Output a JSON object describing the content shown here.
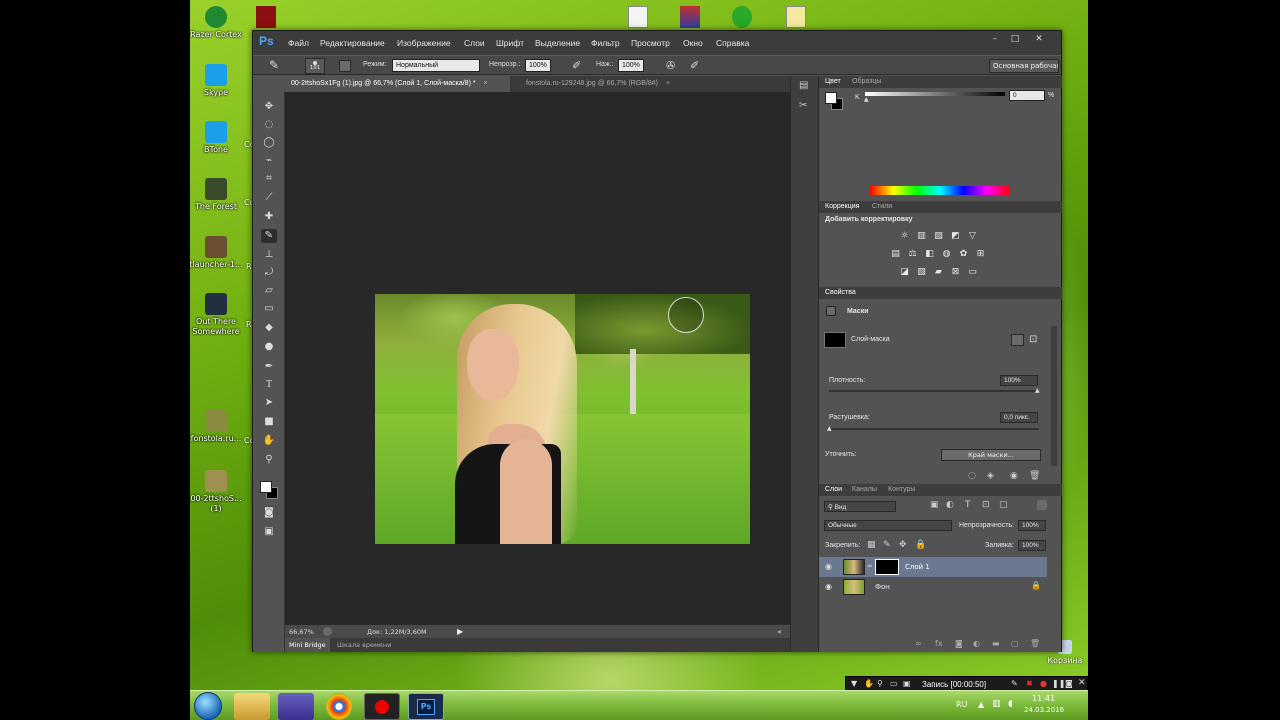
{
  "desktop": {
    "icons": [
      {
        "label": "Razer Cortex",
        "icon": "razer-cortex-icon",
        "color": "#1f8a2f"
      },
      {
        "label": "Skype",
        "icon": "skype-icon",
        "color": "#1aa0e6"
      },
      {
        "label": "BTone",
        "icon": "btone-icon",
        "color": "#1aa0e6"
      },
      {
        "label": "The Forest",
        "icon": "the-forest-icon",
        "color": "#3a4a2a"
      },
      {
        "label": "tlauncher-1...",
        "icon": "tlauncher-icon",
        "color": "#6a5030"
      },
      {
        "label": "Out There Somewhere",
        "icon": "out-there-somewhere-icon",
        "color": "#203040"
      },
      {
        "label": "fonstola.ru...",
        "icon": "image-file-icon",
        "color": "#8a8a40"
      },
      {
        "label": "00-2ttshoS... (1)",
        "icon": "image-file-icon",
        "color": "#a09050"
      }
    ],
    "partial_labels": [
      "Co",
      "Co",
      "R",
      "R",
      "Co"
    ],
    "recycle_bin": "Корзина"
  },
  "photoshop": {
    "logo": "Ps",
    "menu": [
      "Файл",
      "Редактирование",
      "Изображение",
      "Слои",
      "Шрифт",
      "Выделение",
      "Фильтр",
      "Просмотр",
      "Окно",
      "Справка"
    ],
    "window_buttons": [
      "–",
      "□",
      "✕"
    ],
    "options": {
      "brush_size": "101",
      "mode_label": "Режим:",
      "mode_value": "Нормальный",
      "opacity_label": "Непрозр.:",
      "opacity_value": "100%",
      "pressure_label": "Наж.:",
      "pressure_value": "100%",
      "workspace": "Основная рабочая с"
    },
    "tabs": [
      {
        "label": "00-2ttshoSx1Fg (1).jpg @ 66,7% (Слой 1, Слой-маска/8) *",
        "active": true
      },
      {
        "label": "fonstola.ru-129248.jpg @ 66,7% (RGB/8#)",
        "active": false
      }
    ],
    "status": {
      "zoom": "66,67%",
      "doc": "Док: 1,22М/3,60М"
    },
    "bottom_tabs": [
      "Mini Bridge",
      "Шкала времени"
    ],
    "color_panel": {
      "tabs": [
        "Цвет",
        "Образцы"
      ],
      "channel": "K",
      "value": "0",
      "unit": "%"
    },
    "adjustments_panel": {
      "tabs": [
        "Коррекция",
        "Стили"
      ],
      "title": "Добавить корректировку"
    },
    "properties_panel": {
      "tab": "Свойства",
      "section": "Маски",
      "mask_name": "Слой-маска",
      "density_label": "Плотность:",
      "density_value": "100%",
      "feather_label": "Растушевка:",
      "feather_value": "0,0 пикс.",
      "refine_label": "Уточнить:",
      "refine_button": "Край маски..."
    },
    "layers_panel": {
      "tabs": [
        "Слои",
        "Каналы",
        "Контуры"
      ],
      "filter_kind": "Вид",
      "blend_mode": "Обычные",
      "opacity_label": "Непрозрачность:",
      "opacity_value": "100%",
      "lock_label": "Закрепить:",
      "fill_label": "Заливка:",
      "fill_value": "100%",
      "layers": [
        {
          "name": "Слой 1",
          "selected": true
        },
        {
          "name": "Фон",
          "selected": false
        }
      ]
    }
  },
  "recorder": {
    "label": "Запись [00:00:50]"
  },
  "taskbar": {
    "lang": "RU",
    "time": "11:41",
    "date": "24.03.2016"
  }
}
